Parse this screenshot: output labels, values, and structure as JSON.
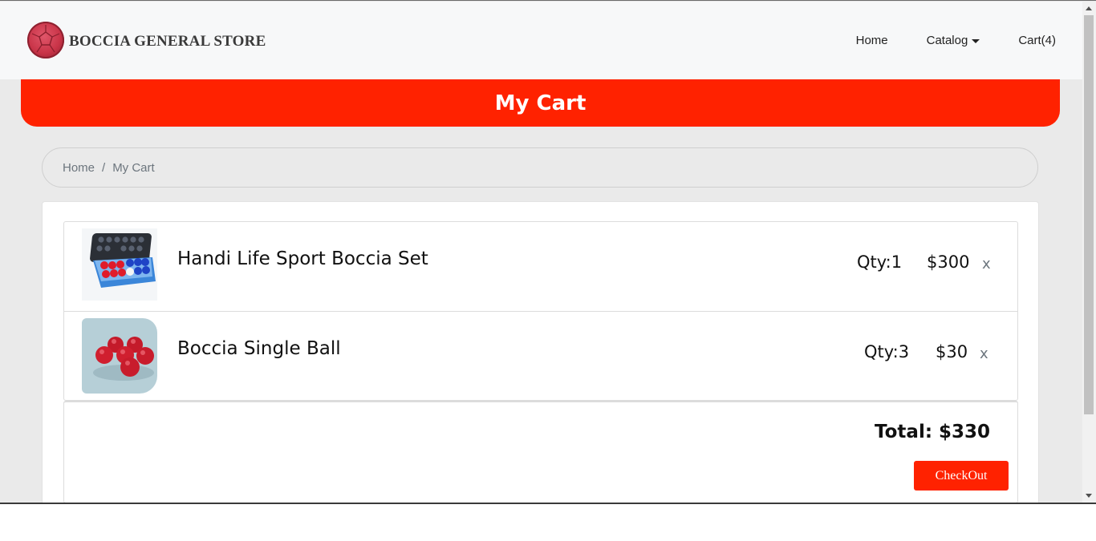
{
  "brand": {
    "name": "BOCCIA GENERAL STORE",
    "logo_icon": "boccia-ball-logo"
  },
  "nav": {
    "home": "Home",
    "catalog": "Catalog",
    "cart": "Cart(4)"
  },
  "banner": {
    "title": "My Cart"
  },
  "breadcrumb": {
    "home": "Home",
    "separator": "/",
    "current": "My Cart"
  },
  "cart": {
    "items": [
      {
        "name": "Handi Life Sport Boccia Set",
        "qty": "Qty:1",
        "price": "$300",
        "remove": "x",
        "image": "boccia-set-case-image"
      },
      {
        "name": "Boccia Single Ball",
        "qty": "Qty:3",
        "price": "$30",
        "remove": "x",
        "image": "red-boccia-balls-image"
      }
    ],
    "total": "Total: $330",
    "checkout_label": "CheckOut"
  },
  "colors": {
    "accent": "#ff2200",
    "navbar_bg": "#f7f8f9",
    "page_bg": "#eaeaea"
  }
}
